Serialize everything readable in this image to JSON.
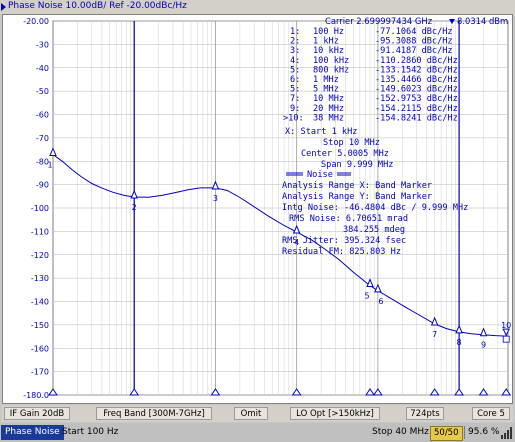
{
  "window": {
    "title": "Phase Noise 10.00dB/ Ref -20.00dBc/Hz"
  },
  "header": {
    "carrier": "Carrier 2.699997434 GHz",
    "level": "8.0314 dBm"
  },
  "y_axis": {
    "labels": [
      "-20.00",
      "-30",
      "-40",
      "-50",
      "-60",
      "-70",
      "-80",
      "-90",
      "-100",
      "-110",
      "-120",
      "-130",
      "-140",
      "-150",
      "-160",
      "-170",
      "-180.0"
    ]
  },
  "marker_table": [
    {
      "num": "1:",
      "freq": "100 Hz",
      "value": "-77.1064 dBc/Hz"
    },
    {
      "num": "2:",
      "freq": "1 kHz",
      "value": "-95.3088 dBc/Hz"
    },
    {
      "num": "3:",
      "freq": "10 kHz",
      "value": "-91.4187 dBc/Hz"
    },
    {
      "num": "4:",
      "freq": "100 kHz",
      "value": "-110.2860 dBc/Hz"
    },
    {
      "num": "5:",
      "freq": "800 kHz",
      "value": "-133.1542 dBc/Hz"
    },
    {
      "num": "6:",
      "freq": "1 MHz",
      "value": "-135.4466 dBc/Hz"
    },
    {
      "num": "5:",
      "freq": "5 MHz",
      "value": "-149.6023 dBc/Hz"
    },
    {
      "num": "7:",
      "freq": "10 MHz",
      "value": "-152.9753 dBc/Hz"
    },
    {
      "num": "9:",
      "freq": "20 MHz",
      "value": "-154.2115 dBc/Hz"
    },
    {
      "num": ">10:",
      "freq": "38 MHz",
      "value": "-154.8241 dBc/Hz"
    }
  ],
  "span_info": {
    "x_start": "X: Start 1 kHz",
    "stop": "Stop 10 MHz",
    "center": "Center 5.0005 MHz",
    "span": "Span 9.999 MHz"
  },
  "noise_info": {
    "heading": "Noise",
    "range_x": "Analysis Range X: Band Marker",
    "range_y": "Analysis Range Y: Band Marker",
    "intg": "Intg Noise: -46.4804 dBc / 9.999 MHz",
    "rms_noise": "RMS Noise: 6.70651 mrad",
    "rms_deg": "384.255 mdeg",
    "rms_jitter": "RMS Jitter: 395.324 fsec",
    "residual_fm": "Residual FM: 825.803 Hz"
  },
  "marker_labels": [
    "1",
    "2",
    "3",
    "4",
    "5",
    "6",
    "7",
    "8",
    "9",
    "10"
  ],
  "softkeys": {
    "if_gain": "IF Gain 20dB",
    "freq_band": "Freq Band [300M-7GHz]",
    "omit": "Omit",
    "lo_opt": "LO Opt [>150kHz]",
    "points": "724pts",
    "core": "Core 5"
  },
  "statusbar": {
    "mode": "Phase Noise",
    "start": "Start 100 Hz",
    "stop": "Stop 40 MHz",
    "avg": "50/50",
    "percent": "95.6 %"
  },
  "colors": {
    "trace": "#0000c0",
    "grid": "#b4b4b4",
    "status_mode_bg": "#1a3a9a",
    "avg_badge_bg": "#e6c84a"
  },
  "chart_data": {
    "type": "line",
    "xscale": "log",
    "xlim": [
      100,
      40000000
    ],
    "ylim": [
      -180,
      -20
    ],
    "markers": [
      {
        "id": "1",
        "x": 100,
        "y": -77.1064
      },
      {
        "id": "2",
        "x": 1000,
        "y": -95.3088
      },
      {
        "id": "3",
        "x": 10000,
        "y": -91.4187
      },
      {
        "id": "4",
        "x": 100000,
        "y": -110.286
      },
      {
        "id": "5",
        "x": 800000,
        "y": -133.1542
      },
      {
        "id": "6",
        "x": 1000000,
        "y": -135.4466
      },
      {
        "id": "7",
        "x": 5000000,
        "y": -149.6023
      },
      {
        "id": "8",
        "x": 10000000,
        "y": -152.9753
      },
      {
        "id": "9",
        "x": 20000000,
        "y": -154.2115
      },
      {
        "id": "10",
        "x": 38000000,
        "y": -154.8241
      }
    ],
    "trace": [
      [
        100,
        -77.1
      ],
      [
        130,
        -80
      ],
      [
        170,
        -83.5
      ],
      [
        220,
        -86.5
      ],
      [
        300,
        -89.5
      ],
      [
        400,
        -91.5
      ],
      [
        550,
        -93.3
      ],
      [
        750,
        -94.6
      ],
      [
        1000,
        -95.3
      ],
      [
        1500,
        -95.4
      ],
      [
        2200,
        -94.6
      ],
      [
        3200,
        -93.4
      ],
      [
        4600,
        -92.2
      ],
      [
        6500,
        -91.4
      ],
      [
        10000,
        -91.4
      ],
      [
        14000,
        -92.5
      ],
      [
        20000,
        -95.5
      ],
      [
        30000,
        -99.5
      ],
      [
        45000,
        -103.5
      ],
      [
        70000,
        -107.5
      ],
      [
        100000,
        -110.3
      ],
      [
        150000,
        -113.5
      ],
      [
        220000,
        -117.5
      ],
      [
        330000,
        -122
      ],
      [
        500000,
        -127.5
      ],
      [
        800000,
        -133.2
      ],
      [
        1000000,
        -135.4
      ],
      [
        1500000,
        -139
      ],
      [
        2200000,
        -142.5
      ],
      [
        3300000,
        -146
      ],
      [
        5000000,
        -149.6
      ],
      [
        7000000,
        -151.6
      ],
      [
        10000000,
        -153
      ],
      [
        14000000,
        -153.8
      ],
      [
        20000000,
        -154.2
      ],
      [
        28000000,
        -154.6
      ],
      [
        38000000,
        -154.8
      ],
      [
        40000000,
        -154.8
      ]
    ],
    "band_markers": [
      1000,
      10000000
    ]
  }
}
